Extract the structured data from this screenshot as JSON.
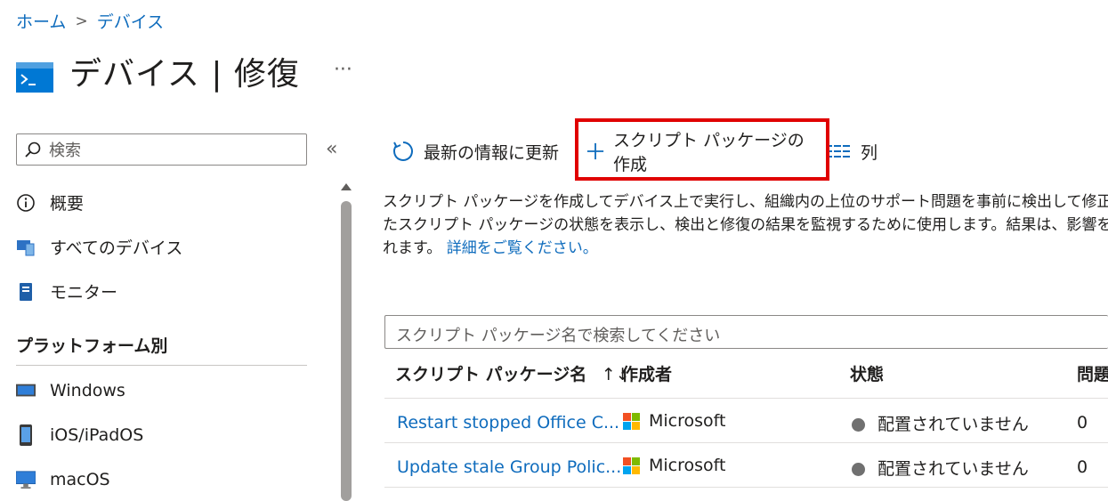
{
  "breadcrumb": {
    "home": "ホーム",
    "separator": ">",
    "current": "デバイス"
  },
  "header": {
    "title": "デバイス | 修復",
    "more": "···"
  },
  "sidebar": {
    "search_placeholder": "検索",
    "collapse": "«",
    "items": [
      {
        "label": "概要",
        "icon": "info-icon"
      },
      {
        "label": "すべてのデバイス",
        "icon": "devices-icon"
      },
      {
        "label": "モニター",
        "icon": "monitor-icon"
      }
    ],
    "section_title": "プラットフォーム別",
    "platforms": [
      {
        "label": "Windows",
        "icon": "windows-device-icon"
      },
      {
        "label": "iOS/iPadOS",
        "icon": "ios-device-icon"
      },
      {
        "label": "macOS",
        "icon": "macos-device-icon"
      }
    ]
  },
  "toolbar": {
    "refresh_label": "最新の情報に更新",
    "create_label": "スクリプト パッケージの作成",
    "columns_label": "列"
  },
  "description": {
    "line1": "スクリプト パッケージを作成してデバイス上で実行し、組織内の上位のサポート問題を事前に検出して修正",
    "line2": "たスクリプト パッケージの状態を表示し、検出と修復の結果を監視するために使用します。結果は、影響を",
    "line3": "れます。",
    "link": "詳細をご覧ください。"
  },
  "package_search": {
    "placeholder": "スクリプト パッケージ名で検索してください"
  },
  "table": {
    "headers": {
      "name": "スクリプト パッケージ名",
      "sort": "↑↓",
      "author": "作成者",
      "status": "状態",
      "issues": "問題"
    },
    "rows": [
      {
        "name": "Restart stopped Office C...",
        "author": "Microsoft",
        "status": "配置されていません",
        "issues": "0"
      },
      {
        "name": "Update stale Group Polic...",
        "author": "Microsoft",
        "status": "配置されていません",
        "issues": "0"
      }
    ]
  },
  "colors": {
    "accent": "#0f6cbd",
    "highlight": "#e00000",
    "ms_red": "#f25022",
    "ms_green": "#7fba00",
    "ms_blue": "#00a4ef",
    "ms_yellow": "#ffb900"
  }
}
